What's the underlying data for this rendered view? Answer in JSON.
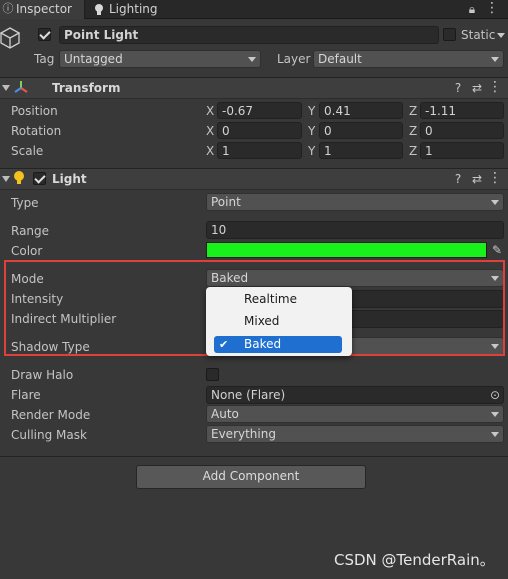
{
  "tabs": [
    {
      "label": "Inspector",
      "icon": "info-icon"
    },
    {
      "label": "Lighting",
      "icon": "bulb-icon"
    }
  ],
  "object": {
    "name": "Point Light",
    "active": true,
    "static_label": "Static",
    "static": false,
    "tag_label": "Tag",
    "tag_value": "Untagged",
    "layer_label": "Layer",
    "layer_value": "Default"
  },
  "transform": {
    "title": "Transform",
    "rows": [
      {
        "label": "Position",
        "x": "-0.67",
        "y": "0.41",
        "z": "-1.11"
      },
      {
        "label": "Rotation",
        "x": "0",
        "y": "0",
        "z": "0"
      },
      {
        "label": "Scale",
        "x": "1",
        "y": "1",
        "z": "1"
      }
    ],
    "axis_labels": [
      "X",
      "Y",
      "Z"
    ]
  },
  "light": {
    "title": "Light",
    "enabled": true,
    "type_label": "Type",
    "type_value": "Point",
    "range_label": "Range",
    "range_value": "10",
    "color_label": "Color",
    "color_value": "#19f21a",
    "mode_label": "Mode",
    "mode_value": "Baked",
    "intensity_label": "Intensity",
    "indirect_label": "Indirect Multiplier",
    "shadow_label": "Shadow Type",
    "halo_label": "Draw Halo",
    "halo": false,
    "flare_label": "Flare",
    "flare_value": "None (Flare)",
    "render_mode_label": "Render Mode",
    "render_mode_value": "Auto",
    "culling_label": "Culling Mask",
    "culling_value": "Everything"
  },
  "mode_menu": {
    "options": [
      "Realtime",
      "Mixed",
      "Baked"
    ],
    "selected": "Baked"
  },
  "add_component_label": "Add Component",
  "watermark": "CSDN @TenderRain。",
  "colors": {
    "highlight_box": "#e0403a",
    "menu_selection": "#1f6fd1",
    "light_color": "#19f21a"
  }
}
